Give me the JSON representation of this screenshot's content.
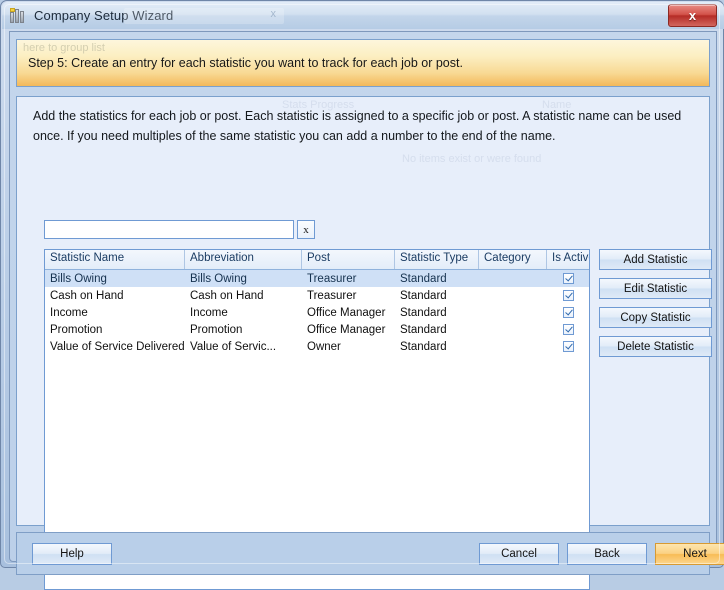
{
  "window": {
    "title": "Company Setup Wizard",
    "icon": "bar-chart-icon",
    "close_label": "x",
    "title_ghost": "x"
  },
  "banner": {
    "text": "Step 5: Create an entry for each statistic you want to track for each job or post.",
    "ghost_text": "here to group list"
  },
  "instructions": {
    "text": "Add the statistics for each job or post. Each statistic is assigned to a specific job or post. A statistic name can be used once. If you need multiples of the same statistic you can add a number to the end of the name.",
    "ghost_a": "Stats Progress",
    "ghost_b": "Name",
    "ghost_c": "No items exist or were found"
  },
  "search": {
    "value": "",
    "placeholder": "",
    "clear_label": "x"
  },
  "grid": {
    "columns": [
      "Statistic Name",
      "Abbreviation",
      "Post",
      "Statistic Type",
      "Category",
      "Is Active"
    ],
    "rows": [
      {
        "name": "Bills Owing",
        "abbreviation": "Bills Owing",
        "post": "Treasurer",
        "type": "Standard",
        "category": "",
        "is_active": true,
        "selected": true
      },
      {
        "name": "Cash on Hand",
        "abbreviation": "Cash on Hand",
        "post": "Treasurer",
        "type": "Standard",
        "category": "",
        "is_active": true,
        "selected": false
      },
      {
        "name": "Income",
        "abbreviation": "Income",
        "post": "Office Manager",
        "type": "Standard",
        "category": "",
        "is_active": true,
        "selected": false
      },
      {
        "name": "Promotion",
        "abbreviation": "Promotion",
        "post": "Office Manager",
        "type": "Standard",
        "category": "",
        "is_active": true,
        "selected": false
      },
      {
        "name": "Value of Service Delivered",
        "abbreviation": "Value of Servic...",
        "post": "Owner",
        "type": "Standard",
        "category": "",
        "is_active": true,
        "selected": false
      }
    ]
  },
  "side_buttons": {
    "add": "Add Statistic",
    "edit": "Edit Statistic",
    "copy": "Copy Statistic",
    "delete": "Delete Statistic"
  },
  "footer": {
    "help": "Help",
    "cancel": "Cancel",
    "back": "Back",
    "next": "Next"
  },
  "colors": {
    "banner_start": "#fdf6dc",
    "banner_end": "#f3b85a",
    "accent_border": "#6f9ad3",
    "selection": "#cfe0f6",
    "next_button": "#f8bc55",
    "close_button": "#b52c26"
  }
}
